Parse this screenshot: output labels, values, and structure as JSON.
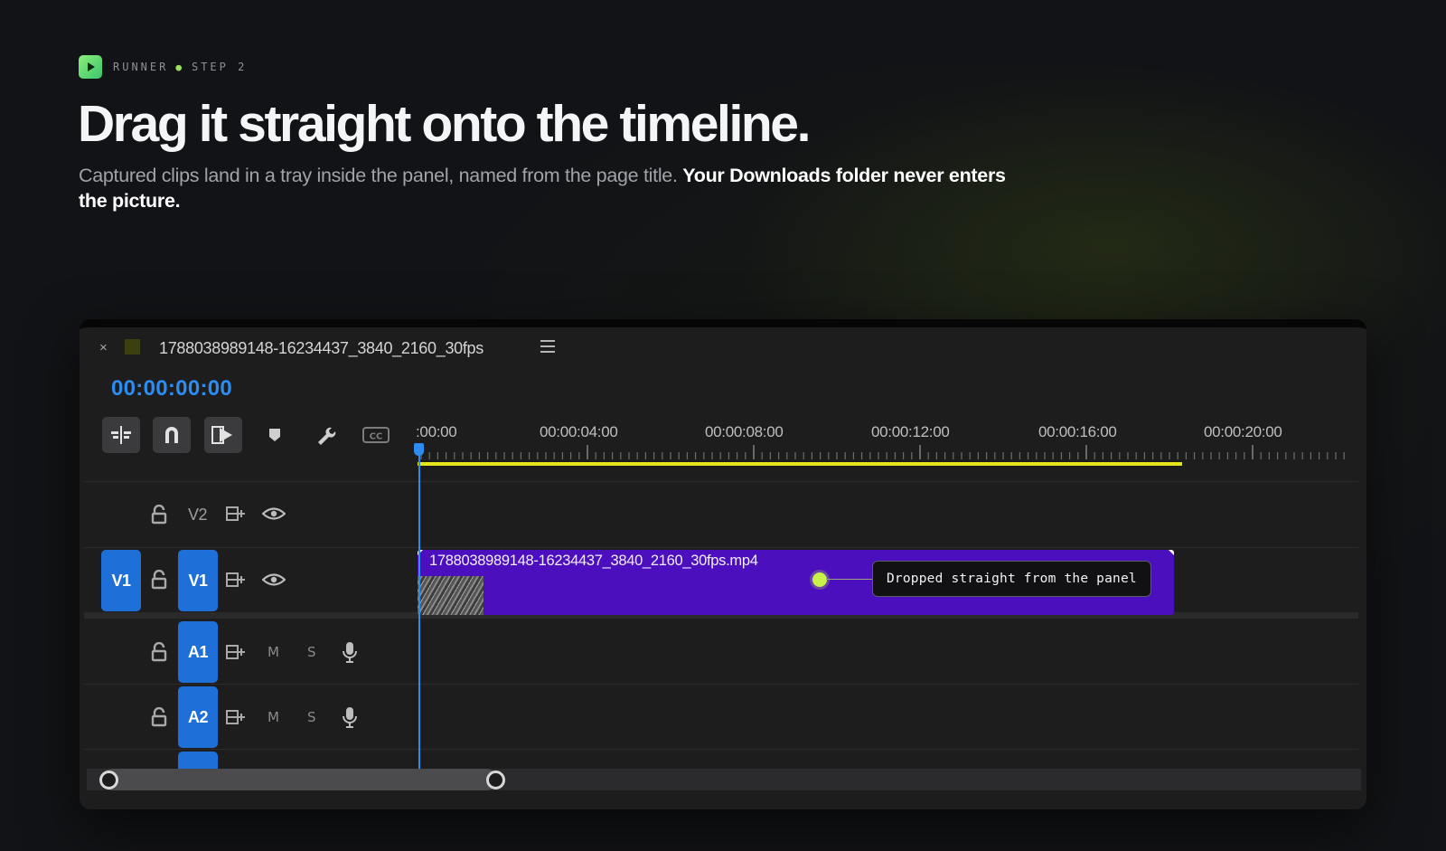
{
  "header": {
    "brand": "RUNNER",
    "step": "STEP 2",
    "title": "Drag it straight onto the timeline.",
    "subtitle_plain": "Captured clips land in a tray inside the panel, named from the page title. ",
    "subtitle_bold": "Your Downloads folder never enters the picture."
  },
  "sequence": {
    "close_glyph": "×",
    "name": "1788038989148-16234437_3840_2160_30fps",
    "timecode": "00:00:00:00",
    "icons": [
      "insert-edit-icon",
      "snap-magnet-icon",
      "linked-selection-icon",
      "add-marker-icon",
      "wrench-icon",
      "captions-icon",
      "hamburger-menu-icon"
    ]
  },
  "ruler": {
    "labels": [
      ":00:00",
      "00:00:04:00",
      "00:00:08:00",
      "00:00:12:00",
      "00:00:16:00",
      "00:00:20:00"
    ]
  },
  "tracks": {
    "v2": {
      "label": "V2"
    },
    "v1": {
      "source_label": "V1",
      "label": "V1"
    },
    "a1": {
      "label": "A1",
      "mute": "M",
      "solo": "S"
    },
    "a2": {
      "label": "A2",
      "mute": "M",
      "solo": "S"
    }
  },
  "clip": {
    "name": "1788038989148-16234437_3840_2160_30fps.mp4",
    "color": "#4b0fbe"
  },
  "callout": {
    "text": "Dropped straight from the panel"
  },
  "colors": {
    "accent_blue": "#2d8cf0",
    "track_blue": "#1f6fd8",
    "work_area_yellow": "#e6e61a",
    "callout_dot": "#c8f24a",
    "logo_green": "#6ee07a"
  }
}
